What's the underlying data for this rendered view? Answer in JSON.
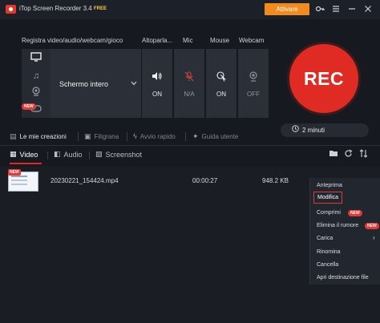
{
  "titlebar": {
    "title": "iTop Screen Recorder 3.4",
    "badge": "FREE",
    "activate_label": "Attivare",
    "icons": [
      "key-icon",
      "menu-icon",
      "minimize-icon",
      "close-icon"
    ]
  },
  "sections": {
    "record_label": "Registra video/audio/webcam/gioco",
    "speaker_label": "Altoparla...",
    "mic_label": "Mic",
    "mouse_label": "Mouse",
    "webcam_label": "Webcam"
  },
  "modes": {
    "items": [
      "monitor-icon",
      "music-note-icon",
      "webcam-icon",
      "gamepad-icon"
    ],
    "new_badge": "NEW"
  },
  "screen_select": {
    "label": "Schermo intero"
  },
  "devices": {
    "speaker_state": "ON",
    "mic_state": "N/A",
    "mouse_state": "ON",
    "webcam_state": "OFF"
  },
  "rec": {
    "label": "REC"
  },
  "timer": {
    "text": "2 minuti"
  },
  "quick_actions": {
    "my_creations": "Le mie creazioni",
    "watermark": "Filigrana",
    "quick_start": "Avvio rapido",
    "user_guide": "Guida utente"
  },
  "tabs": {
    "video": "Video",
    "audio": "Audio",
    "screenshot": "Screenshot"
  },
  "files": [
    {
      "name": "20230221_154424.mp4",
      "duration": "00:00:27",
      "size": "948.2 KB",
      "badge": "NEW"
    }
  ],
  "context_menu": {
    "preview": "Anteprima",
    "edit": "Modifica",
    "compress": "Comprimi",
    "compress_badge": "NEW",
    "denoise": "Elimina il rumore",
    "denoise_badge": "NEW",
    "upload": "Carica",
    "rename": "Rinomina",
    "delete": "Cancella",
    "open_folder": "Apri destinazione file"
  },
  "colors": {
    "accent_red": "#e02b24",
    "activate_orange": "#f28b1e",
    "free_yellow": "#ffc935"
  }
}
